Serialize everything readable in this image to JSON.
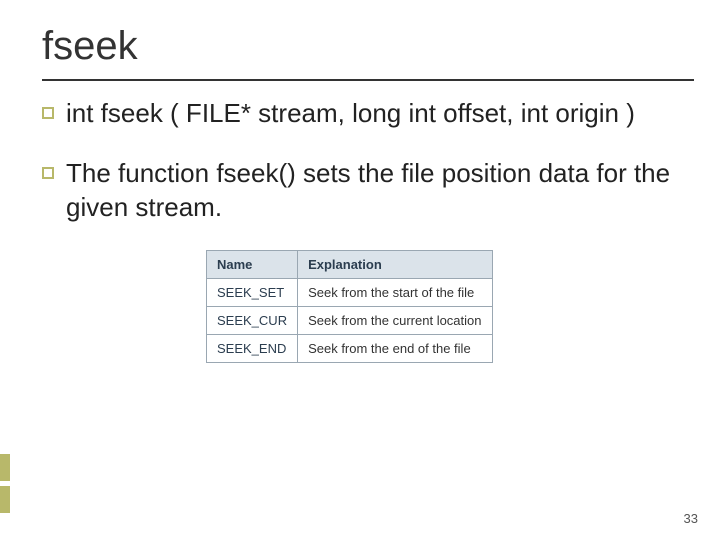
{
  "title": "fseek",
  "bullets": [
    "int fseek ( FILE* stream, long int offset, int origin )",
    "The function fseek() sets the file position data for the given stream."
  ],
  "table": {
    "headers": {
      "name": "Name",
      "explanation": "Explanation"
    },
    "rows": [
      {
        "name": "SEEK_SET",
        "explanation": "Seek from the start of the file"
      },
      {
        "name": "SEEK_CUR",
        "explanation": "Seek from the current location"
      },
      {
        "name": "SEEK_END",
        "explanation": "Seek from the end of the file"
      }
    ]
  },
  "slide_number": "33"
}
